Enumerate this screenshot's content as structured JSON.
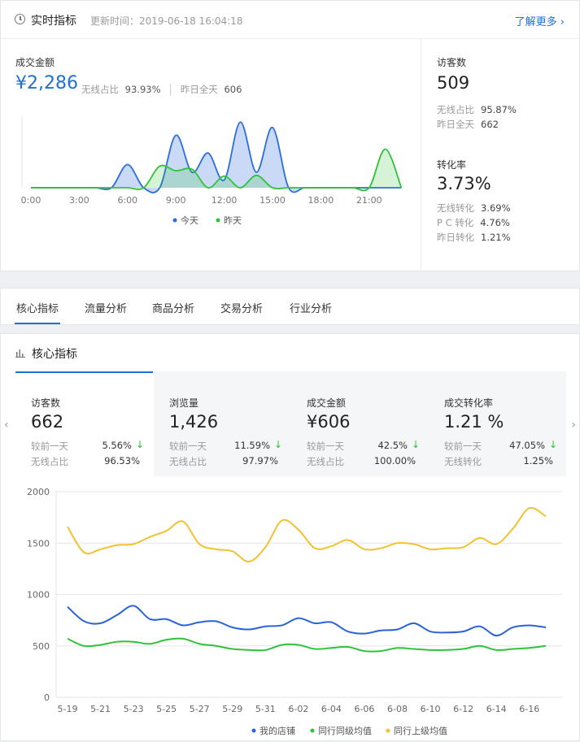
{
  "realtime": {
    "title": "实时指标",
    "update_time": "更新时间：2019-06-18 16:04:18",
    "more_link": "了解更多 ›",
    "gmv": {
      "label": "成交金额",
      "value": "¥2,286",
      "wireless_label": "无线占比",
      "wireless_value": "93.93%",
      "yesterday_label": "昨日全天",
      "yesterday_value": "606"
    },
    "visitors": {
      "label": "访客数",
      "value": "509",
      "wireless_label": "无线占比",
      "wireless_value": "95.87%",
      "yesterday_label": "昨日全天",
      "yesterday_value": "662"
    },
    "conversion": {
      "label": "转化率",
      "value": "3.73%",
      "rows": [
        {
          "label": "无线转化",
          "value": "3.69%"
        },
        {
          "label": "P C 转化",
          "value": "4.76%"
        },
        {
          "label": "昨日转化",
          "value": "1.21%"
        }
      ]
    }
  },
  "realtime_chart": {
    "type": "area",
    "categories": [
      "0:00",
      "3:00",
      "6:00",
      "9:00",
      "12:00",
      "15:00",
      "18:00",
      "21:00"
    ],
    "x": [
      0,
      1,
      2,
      3,
      4,
      5,
      6,
      7,
      8,
      9,
      10,
      11,
      12,
      13,
      14,
      15,
      16,
      17,
      18,
      19,
      20,
      21,
      22,
      23
    ],
    "series": [
      {
        "name": "今天",
        "color": "#2a6ddd",
        "values": [
          0,
          0,
          0,
          0,
          0,
          0,
          30,
          0,
          0,
          68,
          20,
          45,
          10,
          85,
          20,
          78,
          0,
          0,
          0,
          0,
          0,
          0,
          0,
          0
        ]
      },
      {
        "name": "昨天",
        "color": "#31c23a",
        "values": [
          0,
          0,
          0,
          0,
          0,
          0,
          0,
          0,
          28,
          22,
          24,
          0,
          15,
          0,
          16,
          0,
          0,
          0,
          0,
          0,
          0,
          0,
          50,
          0
        ]
      }
    ],
    "legend": "bottom"
  },
  "tabs": [
    "核心指标",
    "流量分析",
    "商品分析",
    "交易分析",
    "行业分析"
  ],
  "core": {
    "title": "核心指标",
    "metrics": [
      {
        "name": "访客数",
        "value": "662",
        "r1_label": "较前一天",
        "r1_value": "5.56%",
        "r2_label": "无线占比",
        "r2_value": "96.53%",
        "trend": "↓"
      },
      {
        "name": "浏览量",
        "value": "1,426",
        "r1_label": "较前一天",
        "r1_value": "11.59%",
        "r2_label": "无线占比",
        "r2_value": "97.97%",
        "trend": "↓"
      },
      {
        "name": "成交金额",
        "value": "¥606",
        "r1_label": "较前一天",
        "r1_value": "42.5%",
        "r2_label": "无线占比",
        "r2_value": "100.00%",
        "trend": "↓"
      },
      {
        "name": "成交转化率",
        "value": "1.21 %",
        "r1_label": "较前一天",
        "r1_value": "47.05%",
        "r2_label": "无线转化",
        "r2_value": "1.25%",
        "trend": "↓"
      }
    ],
    "nav_left": "‹",
    "nav_right": "›"
  },
  "chart_data": {
    "type": "line",
    "categories": [
      "5-19",
      "5-21",
      "5-23",
      "5-25",
      "5-27",
      "5-29",
      "5-31",
      "6-02",
      "6-04",
      "6-06",
      "6-08",
      "6-10",
      "6-12",
      "6-14",
      "6-16"
    ],
    "x": [
      "5-19",
      "5-20",
      "5-21",
      "5-22",
      "5-23",
      "5-24",
      "5-25",
      "5-26",
      "5-27",
      "5-28",
      "5-29",
      "5-30",
      "5-31",
      "6-01",
      "6-02",
      "6-03",
      "6-04",
      "6-05",
      "6-06",
      "6-07",
      "6-08",
      "6-09",
      "6-10",
      "6-11",
      "6-12",
      "6-13",
      "6-14",
      "6-15",
      "6-16",
      "6-17"
    ],
    "ylim": [
      0,
      2000
    ],
    "yticks": [
      0,
      500,
      1000,
      1500,
      2000
    ],
    "series": [
      {
        "name": "我的店铺",
        "color": "#2a63d8",
        "values": [
          880,
          740,
          720,
          800,
          890,
          760,
          760,
          700,
          730,
          740,
          680,
          660,
          690,
          700,
          770,
          720,
          730,
          640,
          620,
          650,
          660,
          720,
          640,
          630,
          640,
          690,
          600,
          680,
          700,
          680
        ]
      },
      {
        "name": "同行同级均值",
        "color": "#2fc23a",
        "values": [
          570,
          500,
          510,
          540,
          540,
          520,
          560,
          570,
          520,
          500,
          470,
          460,
          460,
          510,
          510,
          470,
          480,
          490,
          450,
          450,
          480,
          470,
          460,
          460,
          470,
          500,
          460,
          470,
          480,
          500
        ]
      },
      {
        "name": "同行上级均值",
        "color": "#f2c230",
        "values": [
          1660,
          1410,
          1440,
          1480,
          1490,
          1560,
          1620,
          1710,
          1490,
          1440,
          1420,
          1320,
          1460,
          1720,
          1630,
          1450,
          1470,
          1530,
          1440,
          1450,
          1500,
          1490,
          1440,
          1450,
          1460,
          1550,
          1490,
          1640,
          1840,
          1760
        ]
      }
    ],
    "legend": "bottom",
    "grid": true
  }
}
